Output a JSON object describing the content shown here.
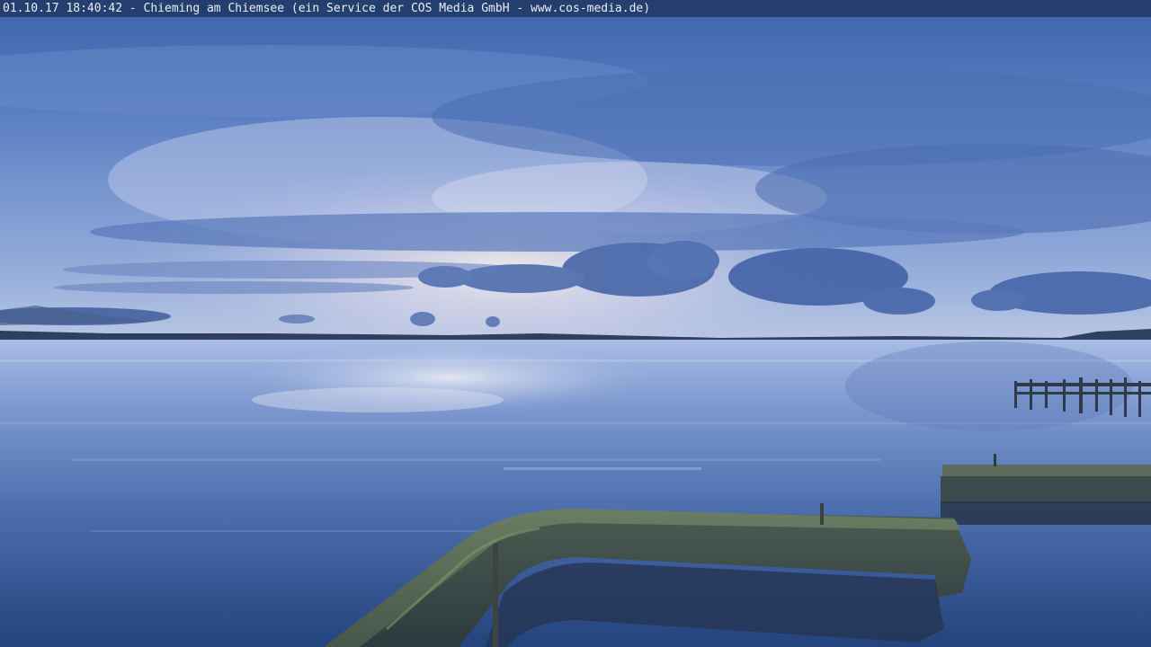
{
  "overlay": {
    "caption": "01.10.17 18:40:42 - Chieming am Chiemsee (ein Service der COS Media GmbH - www.cos-media.de)"
  },
  "scene": {
    "sky_top": "#4a6fb5",
    "sky_mid": "#7f9ed4",
    "horizon_glow": "#e8e2ec",
    "cloud_dark": "#3f5f9f",
    "water_top": "#9db3df",
    "water_bottom": "#1f3d72",
    "shore": "#2a3d5c",
    "pier_stone": "#4c5e55",
    "pier_moss": "#5f7a4e"
  }
}
